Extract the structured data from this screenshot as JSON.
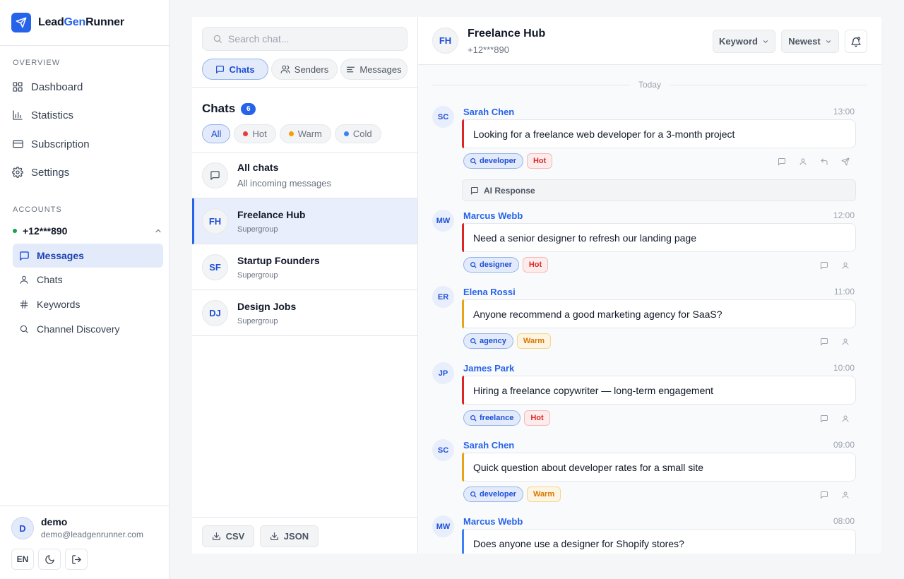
{
  "brand": {
    "part1": "Lead",
    "part2": "Gen",
    "part3": "Runner"
  },
  "sidebar": {
    "overview_label": "OVERVIEW",
    "nav": [
      {
        "label": "Dashboard",
        "icon": "grid-icon"
      },
      {
        "label": "Statistics",
        "icon": "bar-chart-icon"
      },
      {
        "label": "Subscription",
        "icon": "card-icon"
      },
      {
        "label": "Settings",
        "icon": "gear-icon"
      }
    ],
    "accounts_label": "ACCOUNTS",
    "account_phone": "+12***890",
    "account_items": [
      {
        "label": "Messages",
        "icon": "message-icon",
        "active": true
      },
      {
        "label": "Chats",
        "icon": "user-icon"
      },
      {
        "label": "Keywords",
        "icon": "hash-icon"
      },
      {
        "label": "Channel Discovery",
        "icon": "search-icon"
      }
    ],
    "user": {
      "initial": "D",
      "name": "demo",
      "email": "demo@leadgenrunner.com"
    },
    "lang": "EN"
  },
  "chat_panel": {
    "search_placeholder": "Search chat...",
    "tabs": [
      {
        "label": "Chats",
        "active": true
      },
      {
        "label": "Senders"
      },
      {
        "label": "Messages"
      }
    ],
    "title": "Chats",
    "count": "6",
    "filters": [
      {
        "label": "All",
        "active": true
      },
      {
        "label": "Hot",
        "color": "#e53e3e"
      },
      {
        "label": "Warm",
        "color": "#f59e0b"
      },
      {
        "label": "Cold",
        "color": "#3b82f6"
      }
    ],
    "chats": [
      {
        "initials": "",
        "name": "All chats",
        "sub": "All incoming messages"
      },
      {
        "initials": "FH",
        "name": "Freelance Hub",
        "sub": "Supergroup",
        "active": true
      },
      {
        "initials": "SF",
        "name": "Startup Founders",
        "sub": "Supergroup"
      },
      {
        "initials": "DJ",
        "name": "Design Jobs",
        "sub": "Supergroup"
      }
    ],
    "export_csv": "CSV",
    "export_json": "JSON"
  },
  "conversation": {
    "header": {
      "initials": "FH",
      "title": "Freelance Hub",
      "phone": "+12***890",
      "keyword_btn": "Keyword",
      "sort_btn": "Newest"
    },
    "day_divider": "Today",
    "ai_response_label": "AI Response",
    "messages": [
      {
        "initials": "SC",
        "sender": "Sarah Chen",
        "time": "13:00",
        "text": "Looking for a freelance web developer for a 3-month project",
        "keyword": "developer",
        "heat": "Hot"
      },
      {
        "initials": "MW",
        "sender": "Marcus Webb",
        "time": "12:00",
        "text": "Need a senior designer to refresh our landing page",
        "keyword": "designer",
        "heat": "Hot"
      },
      {
        "initials": "ER",
        "sender": "Elena Rossi",
        "time": "11:00",
        "text": "Anyone recommend a good marketing agency for SaaS?",
        "keyword": "agency",
        "heat": "Warm"
      },
      {
        "initials": "JP",
        "sender": "James Park",
        "time": "10:00",
        "text": "Hiring a freelance copywriter — long-term engagement",
        "keyword": "freelance",
        "heat": "Hot"
      },
      {
        "initials": "SC",
        "sender": "Sarah Chen",
        "time": "09:00",
        "text": "Quick question about developer rates for a small site",
        "keyword": "developer",
        "heat": "Warm"
      },
      {
        "initials": "MW",
        "sender": "Marcus Webb",
        "time": "08:00",
        "text": "Does anyone use a designer for Shopify stores?"
      }
    ]
  },
  "colors": {
    "accent": "#2563eb",
    "hot": "#dc2626",
    "warm": "#d97706",
    "cold": "#3b82f6"
  }
}
